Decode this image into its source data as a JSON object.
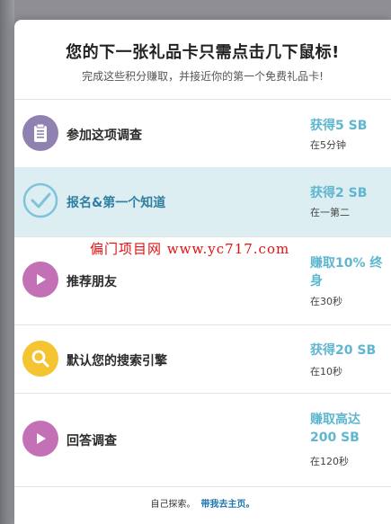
{
  "header": {
    "title": "您的下一张礼品卡只需点击几下鼠标!",
    "subtitle": "完成这些积分赚取，并接近你的第一个免费礼品卡!"
  },
  "offers": [
    {
      "label": "参加这项调查",
      "reward": "获得5 SB",
      "time": "在5分钟",
      "icon": "clipboard-icon",
      "icon_color": "#8f82b0",
      "state": "default"
    },
    {
      "label": "报名&第一个知道",
      "reward": "获得2 SB",
      "time": "在一第二",
      "icon": "checkmark-icon",
      "icon_color": "#7fc2da",
      "state": "completed"
    },
    {
      "label": "推荐朋友",
      "reward": "赚取10% 终身",
      "time": "在30秒",
      "icon": "play-icon",
      "icon_color": "#c370b7",
      "state": "default"
    },
    {
      "label": "默认您的搜索引擎",
      "reward": "获得20 SB",
      "time": "在10秒",
      "icon": "search-icon",
      "icon_color": "#f5c431",
      "state": "default"
    },
    {
      "label": "回答调查",
      "reward": "赚取高达 200 SB",
      "time": "在120秒",
      "icon": "play-icon",
      "icon_color": "#c370b7",
      "state": "default"
    }
  ],
  "watermark": "偏门项目网 www.yc717.com",
  "footer": {
    "text": "自己探索。",
    "link": "带我去主页。"
  },
  "colors": {
    "reward": "#5eb6cf",
    "active_row_bg": "#ddeef3",
    "active_label": "#2f7fa0"
  }
}
